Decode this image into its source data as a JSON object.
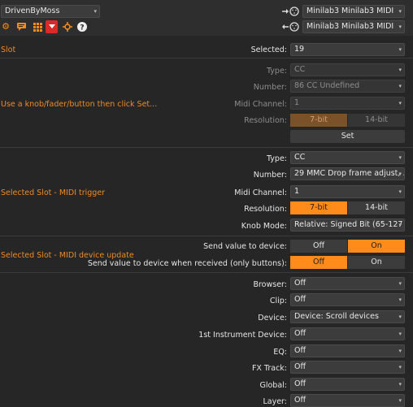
{
  "header": {
    "script_name": "DrivenByMoss",
    "midi_out": "Minilab3 Minilab3 MIDI",
    "midi_in": "Minilab3 Minilab3 MIDI",
    "icons": [
      "gear-icon",
      "comment-icon",
      "grid-icon",
      "record-arrow-icon",
      "crosshair-icon",
      "help-icon",
      "out-arrow-icon",
      "in-arrow-icon"
    ]
  },
  "slot": {
    "section": "Slot",
    "selected_label": "Selected:",
    "selected_value": "19"
  },
  "learn": {
    "section": "Use a knob/fader/button then click Set...",
    "type_label": "Type:",
    "type_value": "CC",
    "number_label": "Number:",
    "number_value": "86  CC Undefined",
    "channel_label": "Midi Channel:",
    "channel_value": "1",
    "resolution_label": "Resolution:",
    "res_7": "7-bit",
    "res_14": "14-bit",
    "set_label": "Set"
  },
  "trigger": {
    "section": "Selected Slot - MIDI trigger",
    "type_label": "Type:",
    "type_value": "CC",
    "number_label": "Number:",
    "number_value": "29  MMC Drop frame adjust, ...",
    "channel_label": "Midi Channel:",
    "channel_value": "1",
    "resolution_label": "Resolution:",
    "res_7": "7-bit",
    "res_14": "14-bit",
    "knob_label": "Knob Mode:",
    "knob_value": "Relative: Signed Bit (65-127 i..."
  },
  "update": {
    "section": "Selected Slot - MIDI device update",
    "send_label": "Send value to device:",
    "send_off": "Off",
    "send_on": "On",
    "recv_label": "Send value to device when received (only buttons):",
    "recv_off": "Off",
    "recv_on": "On"
  },
  "functions": [
    {
      "label": "Browser:",
      "value": "Off"
    },
    {
      "label": "Clip:",
      "value": "Off"
    },
    {
      "label": "Device:",
      "value": "Device: Scroll devices"
    },
    {
      "label": "1st Instrument Device:",
      "value": "Off"
    },
    {
      "label": "EQ:",
      "value": "Off"
    },
    {
      "label": "FX Track:",
      "value": "Off"
    },
    {
      "label": "Global:",
      "value": "Off"
    },
    {
      "label": "Layer:",
      "value": "Off"
    }
  ],
  "colors": {
    "accent": "#ff8c1a",
    "section_text": "#f08a24",
    "background": "#262626"
  }
}
